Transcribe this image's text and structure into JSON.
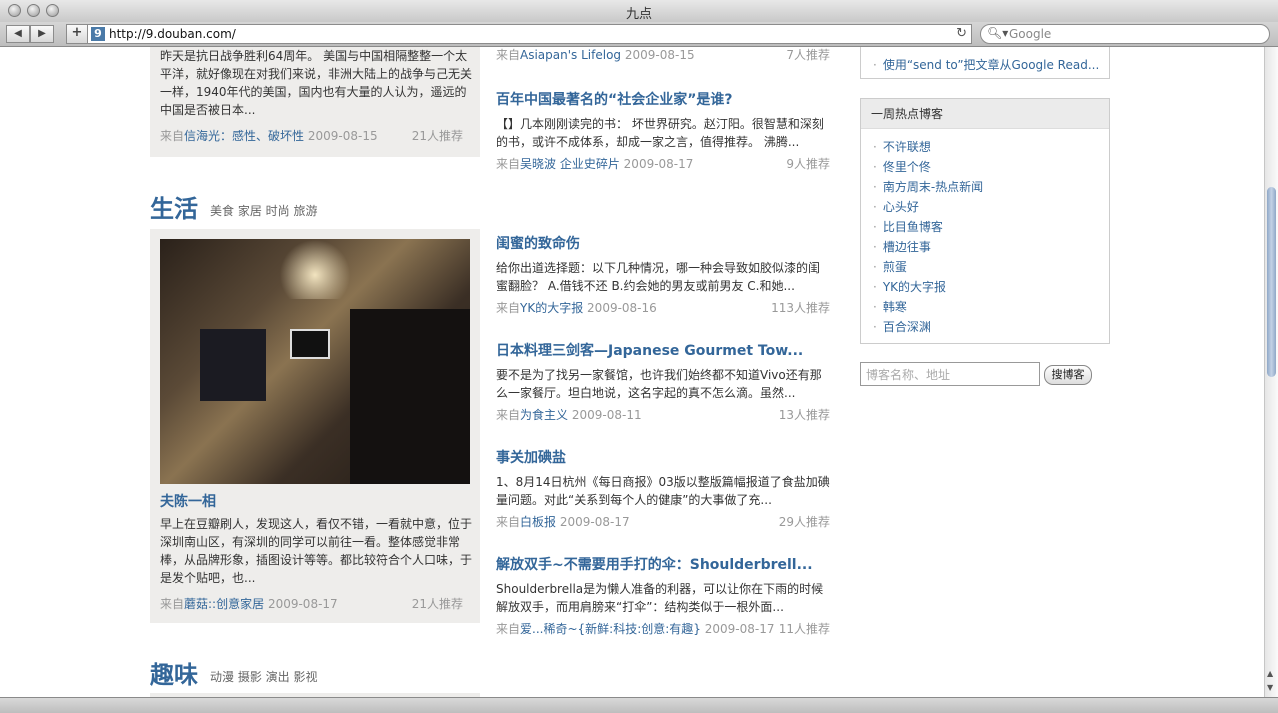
{
  "window": {
    "title": "九点"
  },
  "toolbar": {
    "url": "http://9.douban.com/",
    "search_placeholder": "Google",
    "back_icon": "back-arrow-icon",
    "forward_icon": "forward-arrow-icon",
    "add_icon": "plus-icon",
    "reload_icon": "reload-icon"
  },
  "top_left_post": {
    "snippet": "昨天是抗日战争胜利64周年。 美国与中国相隔整整一个太平洋，就好像现在对我们来说，非洲大陆上的战争与己无关一样，1940年代的美国，国内也有大量的人认为，遥远的中国是否被日本...",
    "from": "来自",
    "source": "信海光：感性、破坏性",
    "date": "2009-08-15",
    "recs": "21人推荐"
  },
  "top_right_partial": {
    "from": "来自",
    "source": "Asiapan's Lifelog",
    "date": "2009-08-15",
    "recs": "7人推荐"
  },
  "top_right_post": {
    "title": "百年中国最著名的“社会企业家”是谁?",
    "snippet": "【】几本刚刚读完的书： 坏世界研究。赵汀阳。很智慧和深刻的书，或许不成体系，却成一家之言，值得推荐。 沸腾...",
    "from": "来自",
    "source": "吴晓波 企业史碎片",
    "date": "2009-08-17",
    "recs": "9人推荐"
  },
  "life_section": {
    "title": "生活",
    "subtitle": "美食 家居 时尚 旅游",
    "feature": {
      "title": "夫陈一相",
      "snippet": "早上在豆瓣刷人，发现这人，看仅不错，一看就中意，位于深圳南山区，有深圳的同学可以前往一看。整体感觉非常棒，从品牌形象，插图设计等等。都比较符合个人口味，于是发个贴吧，也...",
      "from": "来自",
      "source": "蘑菇::创意家居",
      "date": "2009-08-17",
      "recs": "21人推荐"
    },
    "posts": [
      {
        "title": "闺蜜的致命伤",
        "snippet": "给你出道选择题：以下几种情况，哪一种会导致如胶似漆的闺蜜翻脸？ A.借钱不还 B.约会她的男友或前男友 C.和她...",
        "from": "来自",
        "source": "YK的大字报",
        "date": "2009-08-16",
        "recs": "113人推荐"
      },
      {
        "title": "日本料理三剑客—Japanese Gourmet Tow...",
        "snippet": "要不是为了找另一家餐馆，也许我们始终都不知道Vivo还有那么一家餐厅。坦白地说，这名字起的真不怎么滴。虽然...",
        "from": "来自",
        "source": "为食主义",
        "date": "2009-08-11",
        "recs": "13人推荐"
      },
      {
        "title": "事关加碘盐",
        "snippet": "1、8月14日杭州《每日商报》03版以整版篇幅报道了食盐加碘量问题。对此“关系到每个人的健康”的大事做了充...",
        "from": "来自",
        "source": "白板报",
        "date": "2009-08-17",
        "recs": "29人推荐"
      },
      {
        "title": "解放双手~不需要用手打的伞：Shoulderbrell...",
        "snippet": "Shoulderbrella是为懒人准备的利器，可以让你在下雨的时候解放双手，而用肩膀来“打伞”：结构类似于一根外面...",
        "from": "来自",
        "source": "爱...稀奇~{新鲜:科技:创意:有趣}",
        "date": "2009-08-17",
        "recs": "11人推荐"
      }
    ]
  },
  "fun_section": {
    "title": "趣味",
    "subtitle": "动漫 摄影 演出 影视"
  },
  "sidebar": {
    "top_link": "使用“send to”把文章从Google Read...",
    "hot_blogs_title": "一周热点博客",
    "hot_blogs": [
      "不许联想",
      "佟里个佟",
      "南方周末-热点新闻",
      "心头好",
      "比目鱼博客",
      "槽边往事",
      "煎蛋",
      "YK的大字报",
      "韩寒",
      "百合深渊"
    ],
    "blog_search_placeholder": "博客名称、地址",
    "blog_search_button": "搜博客"
  }
}
